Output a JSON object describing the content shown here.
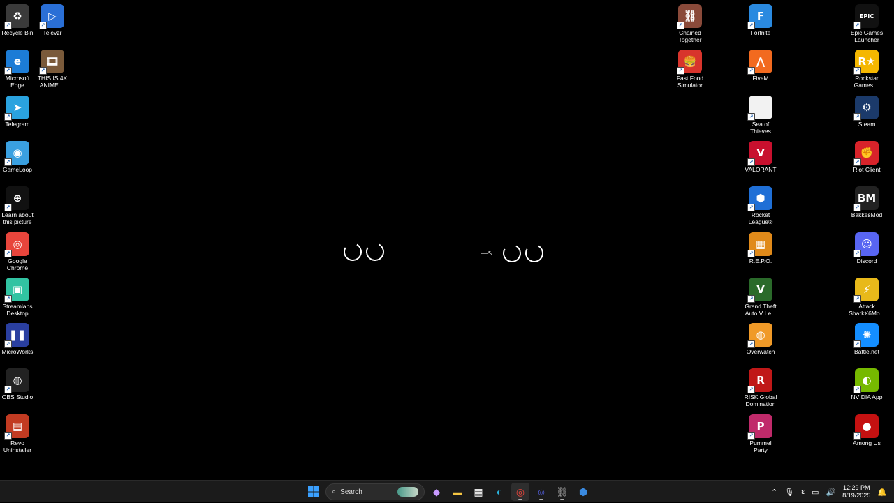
{
  "desktop": {
    "left_icons": [
      {
        "name": "recycle-bin-icon",
        "label": "Recycle Bin",
        "color": "#3a3a3a",
        "glyph": "♻"
      },
      {
        "name": "microsoft-edge-icon",
        "label": "Microsoft\nEdge",
        "color": "#1c7cd6",
        "glyph": "e"
      },
      {
        "name": "telegram-icon",
        "label": "Telegram",
        "color": "#2aa3df",
        "glyph": "➤"
      },
      {
        "name": "gameloop-icon",
        "label": "GameLoop",
        "color": "#3aa0e0",
        "glyph": "◉"
      },
      {
        "name": "learn-picture-icon",
        "label": "Learn about\nthis picture",
        "color": "#111111",
        "glyph": "⊕"
      },
      {
        "name": "google-chrome-icon",
        "label": "Google\nChrome",
        "color": "#e8453c",
        "glyph": "◎"
      },
      {
        "name": "streamlabs-icon",
        "label": "Streamlabs\nDesktop",
        "color": "#31c3a2",
        "glyph": "▣"
      },
      {
        "name": "microworks-icon",
        "label": "MicroWorks",
        "color": "#2a3fa0",
        "glyph": "❚❚"
      },
      {
        "name": "obs-studio-icon",
        "label": "OBS Studio",
        "color": "#222222",
        "glyph": "◍"
      },
      {
        "name": "revo-uninstaller-icon",
        "label": "Revo\nUninstaller",
        "color": "#c23b22",
        "glyph": "▤"
      }
    ],
    "second_col_icons": [
      {
        "name": "televzr-icon",
        "label": "Televzr",
        "color": "#2a6fd6",
        "glyph": "▷"
      },
      {
        "name": "anime-video-icon",
        "label": "THIS IS 4K\nANIME ...",
        "color": "#7a5a3a",
        "glyph": "🎞"
      }
    ],
    "right_col1_icons": [
      {
        "name": "chained-together-icon",
        "label": "Chained\nTogether",
        "color": "#8a4a3a",
        "glyph": "⛓"
      },
      {
        "name": "fast-food-simulator-icon",
        "label": "Fast Food\nSimulator",
        "color": "#d8342c",
        "glyph": "🍔"
      }
    ],
    "right_col2_icons": [
      {
        "name": "fortnite-icon",
        "label": "Fortnite",
        "color": "#2a8ae0",
        "glyph": "F"
      },
      {
        "name": "fivem-icon",
        "label": "FiveM",
        "color": "#f26a1f",
        "glyph": "⋀"
      },
      {
        "name": "sea-of-thieves-icon",
        "label": "Sea of\nThieves",
        "color": "#f2f2f2",
        "glyph": ""
      },
      {
        "name": "valorant-icon",
        "label": "VALORANT",
        "color": "#c8102e",
        "glyph": "V"
      },
      {
        "name": "rocket-league-icon",
        "label": "Rocket\nLeague®",
        "color": "#1f6fd6",
        "glyph": "⬢"
      },
      {
        "name": "repo-icon",
        "label": "R.E.P.O.",
        "color": "#e08a1a",
        "glyph": "▦"
      },
      {
        "name": "gta-v-icon",
        "label": "Grand Theft\nAuto V Le...",
        "color": "#2a6a2a",
        "glyph": "V"
      },
      {
        "name": "overwatch-icon",
        "label": "Overwatch",
        "color": "#f09a28",
        "glyph": "◍"
      },
      {
        "name": "risk-icon",
        "label": "RISK Global\nDomination",
        "color": "#c01818",
        "glyph": "R"
      },
      {
        "name": "pummel-party-icon",
        "label": "Pummel\nParty",
        "color": "#c02a6a",
        "glyph": "P"
      }
    ],
    "right_col3_icons": [
      {
        "name": "epic-games-icon",
        "label": "Epic Games\nLauncher",
        "color": "#111111",
        "glyph": "EPIC"
      },
      {
        "name": "rockstar-icon",
        "label": "Rockstar\nGames ...",
        "color": "#f5b700",
        "glyph": "R★"
      },
      {
        "name": "steam-icon",
        "label": "Steam",
        "color": "#1b3a6a",
        "glyph": "⚙"
      },
      {
        "name": "riot-client-icon",
        "label": "Riot Client",
        "color": "#d8232a",
        "glyph": "✊"
      },
      {
        "name": "bakkesmod-icon",
        "label": "BakkesMod",
        "color": "#222222",
        "glyph": "BM"
      },
      {
        "name": "discord-icon",
        "label": "Discord",
        "color": "#5865f2",
        "glyph": "☺"
      },
      {
        "name": "attack-shark-icon",
        "label": "Attack\nSharkX6Mo...",
        "color": "#e8b91a",
        "glyph": "⚡"
      },
      {
        "name": "battle-net-icon",
        "label": "Battle.net",
        "color": "#148eff",
        "glyph": "✺"
      },
      {
        "name": "nvidia-app-icon",
        "label": "NVIDIA App",
        "color": "#76b900",
        "glyph": "◐"
      },
      {
        "name": "among-us-icon",
        "label": "Among Us",
        "color": "#c51111",
        "glyph": "●"
      }
    ]
  },
  "taskbar": {
    "search_placeholder": "Search",
    "clock_time": "12:29 PM",
    "clock_date": "8/19/2025",
    "ime_label": "ε"
  },
  "colors": {
    "taskbar": "#1b1b1b",
    "desktop": "#000000",
    "accent": "#0067c0"
  }
}
